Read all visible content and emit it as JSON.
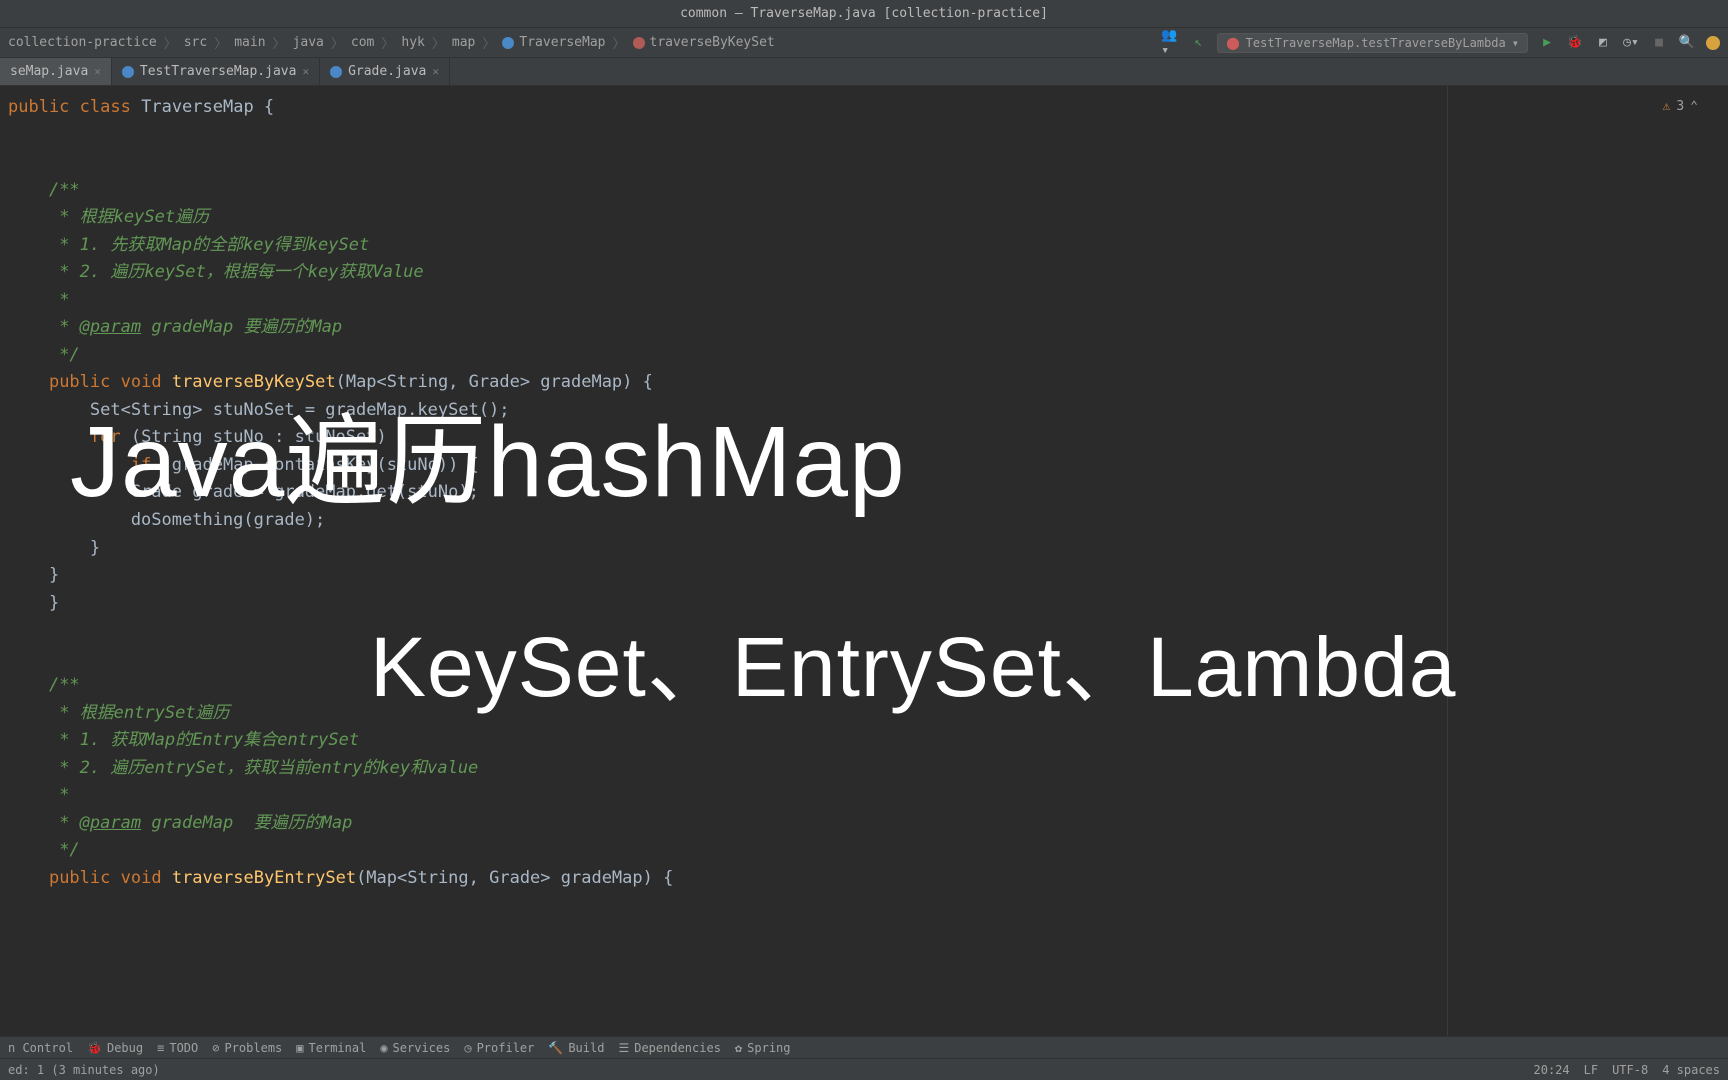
{
  "titlebar": "common — TraverseMap.java [collection-practice]",
  "breadcrumb": [
    "collection-practice",
    "src",
    "main",
    "java",
    "com",
    "hyk",
    "map",
    "TraverseMap",
    "traverseByKeySet"
  ],
  "run_config": "TestTraverseMap.testTraverseByLambda",
  "tabs": [
    {
      "label": "seMap.java",
      "active": true
    },
    {
      "label": "TestTraverseMap.java",
      "active": false
    },
    {
      "label": "Grade.java",
      "active": false
    }
  ],
  "inspection": {
    "warnings": "3"
  },
  "overlay": {
    "line1": "Java遍历hashMap",
    "line2": "KeySet、EntrySet、Lambda"
  },
  "code": {
    "l1_a": "public",
    "l1_b": "class",
    "l1_c": "TraverseMap {",
    "c1": "/**",
    "c2": " * 根据keySet遍历",
    "c3": " * 1. 先获取Map的全部key得到keySet",
    "c4": " * 2. 遍历keySet，根据每一个key获取Value",
    "c5": " *",
    "c6a": " * ",
    "c6b": "@param",
    "c6c": " gradeMap 要遍历的Map",
    "c7": " */",
    "l2_a": "public",
    "l2_b": "void",
    "l2_c": "traverseByKeySet",
    "l2_d": "(Map<String, Grade> gradeMap) {",
    "l3": "    Set<String> stuNoSet = gradeMap.keySet();",
    "l4_a": "for",
    "l4_b": " (String stuNo : stuNoSet) {",
    "l5_a": "if",
    "l5_b": " (gradeMap.containsKey(stuNo)) {",
    "l6": "            Grade grade = gradeMap.get(stuNo);",
    "l7": "            doSomething(grade);",
    "l8": "        }",
    "l9": "    }",
    "l10": "}",
    "d1": "/**",
    "d2": " * 根据entrySet遍历",
    "d3": " * 1. 获取Map的Entry集合entrySet",
    "d4": " * 2. 遍历entrySet，获取当前entry的key和value",
    "d5": " *",
    "d6a": " * ",
    "d6b": "@param",
    "d6c": " gradeMap  要遍历的Map",
    "d7": " */",
    "l11_a": "public",
    "l11_b": "void",
    "l11_c": "traverseByEntrySet",
    "l11_d": "(Map<String, Grade> gradeMap) {"
  },
  "bottombar": [
    "n Control",
    "Debug",
    "TODO",
    "Problems",
    "Terminal",
    "Services",
    "Profiler",
    "Build",
    "Dependencies",
    "Spring"
  ],
  "statusbar": {
    "left": "ed: 1 (3 minutes ago)",
    "right": [
      "20:24",
      "LF",
      "UTF-8",
      "4 spaces"
    ]
  }
}
